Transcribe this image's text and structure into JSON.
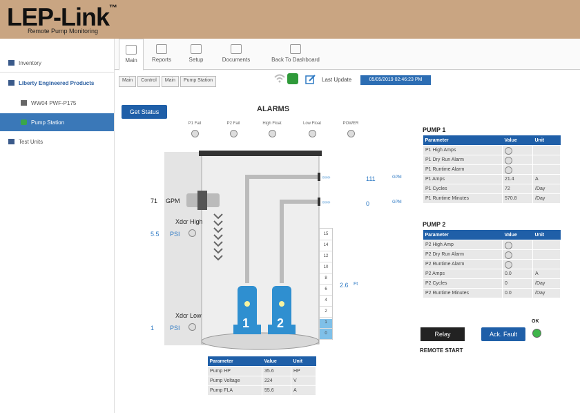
{
  "header": {
    "logo": "LEP-Link",
    "trademark": "™",
    "subtitle": "Remote Pump Monitoring"
  },
  "sidebar": {
    "items": [
      {
        "label": "Inventory"
      },
      {
        "label": "Liberty Engineered Products"
      },
      {
        "label": "WW04 PWF-P175"
      },
      {
        "label": "Pump Station"
      },
      {
        "label": "Test Units"
      }
    ]
  },
  "tabs": [
    {
      "label": "Main"
    },
    {
      "label": "Reports"
    },
    {
      "label": "Setup"
    },
    {
      "label": "Documents"
    },
    {
      "label": "Back To Dashboard"
    }
  ],
  "breadcrumb": [
    "Main",
    "Control",
    "Main",
    "Pump Station"
  ],
  "last_update": {
    "label": "Last Update",
    "value": "05/05/2019 02:46:23 PM"
  },
  "get_status_label": "Get Status",
  "alarms": {
    "title": "ALARMS",
    "items": [
      "P1 Fail",
      "P2 Fail",
      "High Float",
      "Low Float",
      "POWER"
    ]
  },
  "station": {
    "inflow_value": "71",
    "inflow_unit": "GPM",
    "xdcr_high_label": "Xdcr High",
    "xdcr_high_value": "5.5",
    "xdcr_high_unit": "PSI",
    "xdcr_low_label": "Xdcr Low",
    "xdcr_low_value": "1",
    "xdcr_low_unit": "PSI",
    "out1_value": "111",
    "out1_unit": "GPM",
    "out2_value": "0",
    "out2_unit": "GPM",
    "level_value": "2.6",
    "level_unit": "Ft",
    "pump1_num": "1",
    "pump2_num": "2",
    "scale": [
      "15",
      "14",
      "12",
      "10",
      "8",
      "6",
      "4",
      "2",
      "1",
      "0"
    ],
    "level_fill_fraction": 0.18
  },
  "pump1": {
    "title": "PUMP 1",
    "headers": [
      "Parameter",
      "Value",
      "Unit"
    ],
    "rows": [
      [
        "P1 High Amps",
        "",
        ""
      ],
      [
        "P1 Dry Run Alarm",
        "",
        ""
      ],
      [
        "P1 Runtime Alarm",
        "",
        ""
      ],
      [
        "P1 Amps",
        "21.4",
        "A"
      ],
      [
        "P1 Cycles",
        "72",
        "/Day"
      ],
      [
        "P1 Runtime Minutes",
        "570.8",
        "/Day"
      ]
    ]
  },
  "pump2": {
    "title": "PUMP 2",
    "headers": [
      "Parameter",
      "Value",
      "Unit"
    ],
    "rows": [
      [
        "P2 High Amp",
        "",
        ""
      ],
      [
        "P2 Dry Run Alarm",
        "",
        ""
      ],
      [
        "P2 Runtime Alarm",
        "",
        ""
      ],
      [
        "P2 Amps",
        "0.0",
        "A"
      ],
      [
        "P2 Cycles",
        "0",
        "/Day"
      ],
      [
        "P2 Runtime Minutes",
        "0.0",
        "/Day"
      ]
    ]
  },
  "controls": {
    "relay_label": "Relay",
    "ack_label": "Ack. Fault",
    "ok_label": "OK",
    "remote_start_label": "REMOTE START"
  },
  "power_table": {
    "headers": [
      "Parameter",
      "Value",
      "Unit"
    ],
    "rows": [
      [
        "Pump HP",
        "35.6",
        "HP"
      ],
      [
        "Pump Voltage",
        "224",
        "V"
      ],
      [
        "Pump FLA",
        "55.6",
        "A"
      ]
    ]
  },
  "colors": {
    "header_bg": "#c9a582",
    "accent": "#1f5fa8",
    "selected": "#3a78b8"
  }
}
